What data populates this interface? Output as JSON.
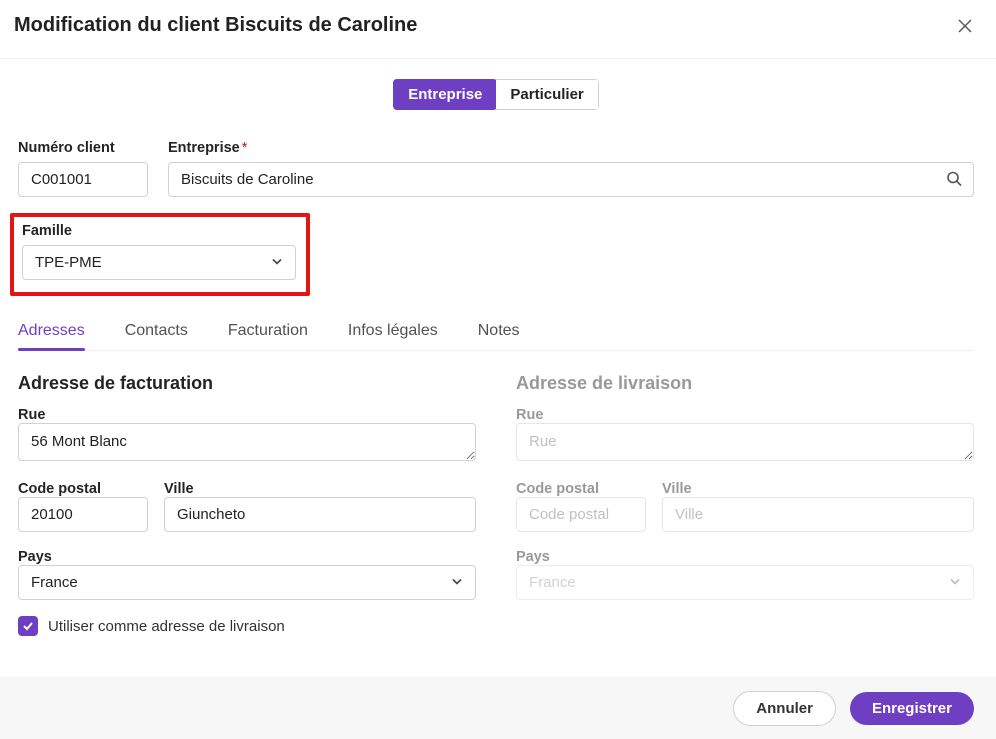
{
  "header": {
    "title": "Modification du client Biscuits de Caroline"
  },
  "segmented": {
    "entreprise": "Entreprise",
    "particulier": "Particulier"
  },
  "fields": {
    "numero_client": {
      "label": "Numéro client",
      "value": "C001001"
    },
    "entreprise": {
      "label": "Entreprise",
      "value": "Biscuits de Caroline",
      "required": true
    },
    "famille": {
      "label": "Famille",
      "value": "TPE-PME"
    }
  },
  "tabs": {
    "adresses": "Adresses",
    "contacts": "Contacts",
    "facturation": "Facturation",
    "infos_legales": "Infos légales",
    "notes": "Notes"
  },
  "billing": {
    "title": "Adresse de facturation",
    "rue": {
      "label": "Rue",
      "value": "56 Mont Blanc"
    },
    "postal": {
      "label": "Code postal",
      "value": "20100"
    },
    "ville": {
      "label": "Ville",
      "value": "Giuncheto"
    },
    "pays": {
      "label": "Pays",
      "value": "France"
    },
    "use_as_shipping": {
      "label": "Utiliser comme adresse de livraison",
      "checked": true
    }
  },
  "shipping": {
    "title": "Adresse de livraison",
    "rue": {
      "label": "Rue",
      "placeholder": "Rue"
    },
    "postal": {
      "label": "Code postal",
      "placeholder": "Code postal"
    },
    "ville": {
      "label": "Ville",
      "placeholder": "Ville"
    },
    "pays": {
      "label": "Pays",
      "value": "France"
    }
  },
  "footer": {
    "cancel": "Annuler",
    "save": "Enregistrer"
  },
  "colors": {
    "accent": "#6e3fc3",
    "danger": "#c50f1f",
    "highlight": "#e11515"
  }
}
